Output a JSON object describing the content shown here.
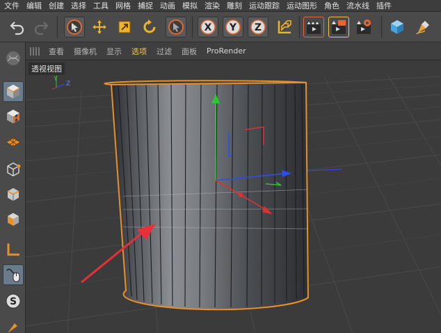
{
  "menu": [
    "文件",
    "编辑",
    "创建",
    "选择",
    "工具",
    "网格",
    "捕捉",
    "动画",
    "模拟",
    "渲染",
    "雕刻",
    "运动跟踪",
    "运动图形",
    "角色",
    "流水线",
    "插件"
  ],
  "toolbar": {
    "tools": [
      "undo-icon",
      "redo-icon",
      "select-pointer-icon",
      "move-icon",
      "scale-icon",
      "rotate-icon",
      "last-tool-icon",
      "x-axis-lock-icon",
      "y-axis-lock-icon",
      "z-axis-lock-icon",
      "coordinate-system-icon",
      "render-view-icon",
      "render-to-picture-viewer-icon",
      "render-settings-icon",
      "cube-icon",
      "pen-icon"
    ],
    "axis_x": "X",
    "axis_y": "Y",
    "axis_z": "Z"
  },
  "sidebar": {
    "tools": [
      "make-editable-icon",
      "model-mode-icon",
      "texture-mode-icon",
      "workplane-icon",
      "points-mode-icon",
      "edges-mode-icon",
      "polygons-mode-icon",
      "enable-axis-icon",
      "tweak-icon",
      "snap-icon"
    ],
    "snap_label": "S"
  },
  "viewport": {
    "menu": [
      "查看",
      "摄像机",
      "显示",
      "选项",
      "过滤",
      "面板",
      "ProRender"
    ],
    "title": "透视视图",
    "gizmo_y": "Y",
    "gizmo_z": "Z"
  },
  "colors": {
    "menubar_bg": "#3d3d3d",
    "toolbar_bg": "#4a4a4a",
    "viewport_bg": "#3b3b3b",
    "selection_orange": "#e8902a",
    "highlight_yellow": "#f0c948",
    "annotation_arrow": "#e8303a",
    "axis_x": "#d93232",
    "axis_y": "#33c233",
    "axis_z": "#2d4fe8"
  }
}
